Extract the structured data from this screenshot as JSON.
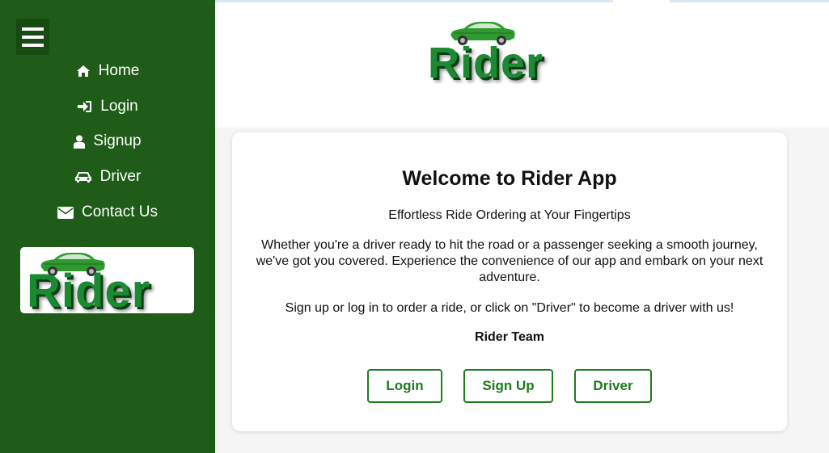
{
  "sidebar": {
    "menu_icon": "hamburger-icon",
    "items": [
      {
        "label": "Home",
        "icon": "home-icon"
      },
      {
        "label": "Login",
        "icon": "sign-in-icon"
      },
      {
        "label": "Signup",
        "icon": "user-icon"
      },
      {
        "label": "Driver",
        "icon": "car-icon"
      },
      {
        "label": "Contact Us",
        "icon": "envelope-icon"
      }
    ],
    "logo_text": "Rider"
  },
  "header": {
    "logo_text": "Rider"
  },
  "card": {
    "title": "Welcome to Rider App",
    "subtitle": "Effortless Ride Ordering at Your Fingertips",
    "body": "Whether you're a driver ready to hit the road or a passenger seeking a smooth journey, we've got you covered. Experience the convenience of our app and embark on your next adventure.",
    "cta": "Sign up or log in to order a ride, or click on \"Driver\" to become a driver with us!",
    "signature": "Rider Team",
    "buttons": {
      "login": "Login",
      "signup": "Sign Up",
      "driver": "Driver"
    }
  },
  "colors": {
    "sidebar": "#1e5c18",
    "accent": "#1e7b1e",
    "logo_green": "#1b8a33"
  }
}
